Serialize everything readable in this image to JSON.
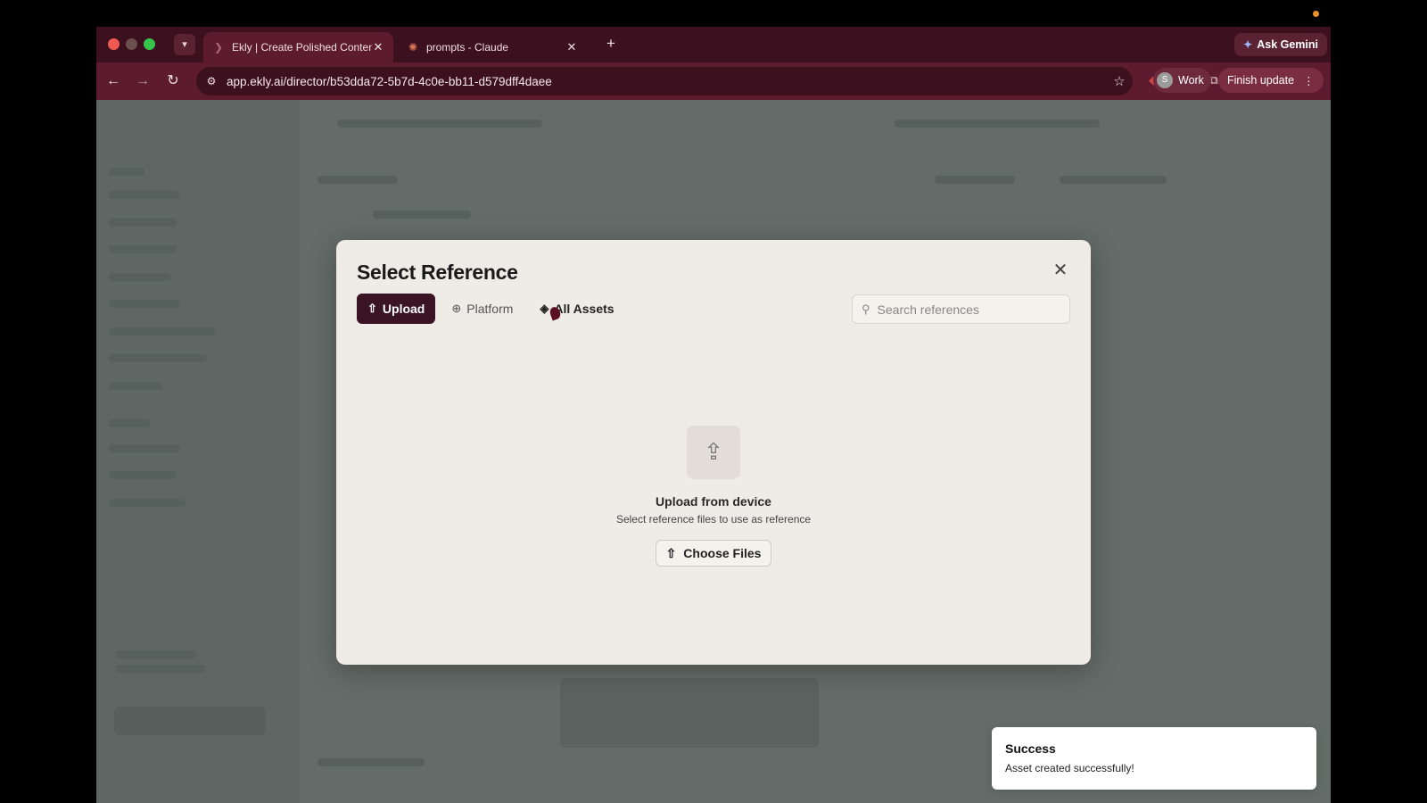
{
  "browser": {
    "tabs": [
      {
        "title": "Ekly | Create Polished Conten",
        "favicon": "ekly-favicon",
        "active": true
      },
      {
        "title": "prompts - Claude",
        "favicon": "claude-favicon",
        "active": false
      }
    ],
    "ask_gemini": "Ask Gemini",
    "url": "app.ekly.ai/director/b53dda72-5b7d-4c0e-bb11-d579dff4daee",
    "profile_initial": "S",
    "profile_label": "Work",
    "finish_update": "Finish update"
  },
  "modal": {
    "title": "Select Reference",
    "tabs": [
      {
        "label": "Upload",
        "icon": "upload-icon"
      },
      {
        "label": "Platform",
        "icon": "globe-icon"
      },
      {
        "label": "All Assets",
        "icon": "layers-icon"
      }
    ],
    "active_tab": "Upload",
    "search_placeholder": "Search references",
    "upload": {
      "title": "Upload from device",
      "subtitle": "Select reference files to use as reference",
      "button": "Choose Files"
    }
  },
  "toast": {
    "title": "Success",
    "message": "Asset created successfully!"
  },
  "colors": {
    "tab_bar": "#3d1020",
    "toolbar": "#5c1b2f",
    "modal_bg": "#efebe6",
    "active_tab": "#3a1324",
    "overlay": "#646c69"
  }
}
